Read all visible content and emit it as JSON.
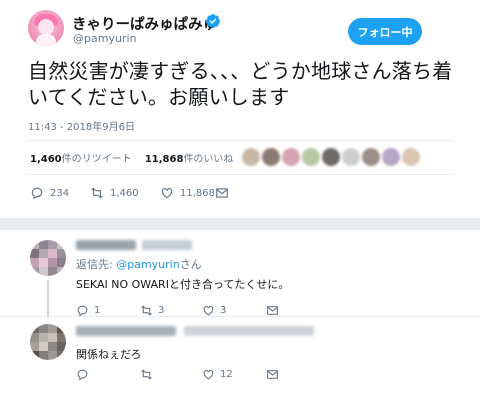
{
  "tweet": {
    "display_name": "きゃりーぱみゅぱみゅ",
    "handle": "@pamyurin",
    "follow_label": "フォロー中",
    "text": "自然災害が凄すぎる、、、どうか地球さん落ち着いてください。お願いします",
    "timestamp": "11:43 - 2018年9月6日",
    "retweets_count": "1,460",
    "retweets_label": "件のリツイート",
    "likes_count": "11,868",
    "likes_label": "件のいいね",
    "actions": {
      "reply_count": "234",
      "retweet_count": "1,460",
      "like_count": "11,868"
    }
  },
  "replies": [
    {
      "reply_to_prefix": "返信先: ",
      "reply_to_mention": "@pamyurin",
      "reply_to_suffix": "さん",
      "text": "SEKAI NO OWARIと付き合ってたくせに。",
      "reply_count": "1",
      "retweet_count": "3",
      "like_count": "3"
    },
    {
      "text": "関係ねぇだろ",
      "reply_count": "",
      "retweet_count": "",
      "like_count": "12"
    }
  ],
  "colors": {
    "accent": "#1da1f2",
    "link": "#1b95e0",
    "secondary_text": "#657786",
    "primary_text": "#14171a",
    "separator": "#e6ecf0"
  },
  "icons": [
    "verified-badge-icon",
    "reply-icon",
    "retweet-icon",
    "like-icon",
    "message-icon"
  ]
}
